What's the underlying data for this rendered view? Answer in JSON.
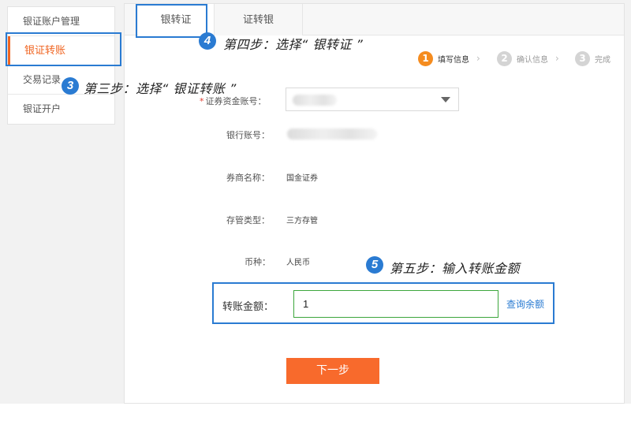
{
  "sidebar": {
    "items": [
      {
        "label": "银证账户管理"
      },
      {
        "label": "银证转账"
      },
      {
        "label": "交易记录"
      },
      {
        "label": "银证开户"
      }
    ]
  },
  "tabs": [
    {
      "label": "银转证"
    },
    {
      "label": "证转银"
    }
  ],
  "steps": [
    {
      "num": "1",
      "label": "填写信息"
    },
    {
      "num": "2",
      "label": "确认信息"
    },
    {
      "num": "3",
      "label": "完成"
    }
  ],
  "form": {
    "securities_account_label": "证券资金账号：",
    "required_mark": "*",
    "bank_account_label": "银行账号：",
    "broker_name_label": "券商名称：",
    "broker_name_value": "国金证券",
    "custody_type_label": "存管类型：",
    "custody_type_value": "三方存管",
    "currency_label": "币种：",
    "currency_value": "人民币",
    "amount_label": "转账金额：",
    "amount_value": "1",
    "query_balance": "查询余额",
    "next_button": "下一步"
  },
  "annotations": {
    "step3": {
      "num": "3",
      "text": "第三步：选择“ 银证转账 ”"
    },
    "step4": {
      "num": "4",
      "text": "第四步：选择“ 银转证 ”"
    },
    "step5": {
      "num": "5",
      "text": "第五步：输入转账金额"
    }
  },
  "colors": {
    "accent_orange": "#f06522",
    "button_orange": "#f86a2c",
    "annotation_blue": "#2a7bd2",
    "input_green": "#3ca63c"
  }
}
